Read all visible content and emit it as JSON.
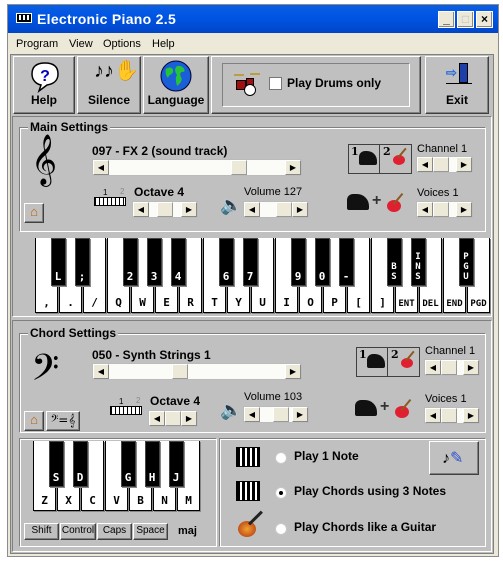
{
  "window": {
    "title": "Electronic Piano 2.5",
    "controls": {
      "minimize": "_",
      "maximize": "□",
      "close": "×"
    }
  },
  "menu": [
    "Program",
    "View",
    "Options",
    "Help"
  ],
  "toolbar": {
    "help": {
      "label": "Help",
      "icon": "question-bubble-icon"
    },
    "silence": {
      "label": "Silence",
      "icon": "notes-hand-icon"
    },
    "language": {
      "label": "Language",
      "icon": "globe-icon"
    },
    "drums": {
      "label": "Play Drums only",
      "checked": false,
      "icon": "drum-kit-icon"
    },
    "exit": {
      "label": "Exit",
      "icon": "exit-door-icon"
    }
  },
  "main_settings": {
    "title": "Main Settings",
    "clef": "treble",
    "instrument": "097 - FX 2 (sound track)",
    "instrument_value": 97,
    "instrument_max": 127,
    "octave_label": "Octave 4",
    "octave_value": 4,
    "octave_scale": [
      "1",
      "2"
    ],
    "volume_label": "Volume 127",
    "volume_value": 127,
    "channel_label": "Channel 1",
    "channel_value": 1,
    "voices_label": "Voices 1",
    "voices_value": 1,
    "channel_tabs": [
      "1",
      "2"
    ],
    "plus": "+"
  },
  "main_keyboard": {
    "white_keys": [
      ",",
      ".",
      "/",
      "Q",
      "W",
      "E",
      "R",
      "T",
      "Y",
      "U",
      "I",
      "O",
      "P",
      "[",
      "]",
      "ENT",
      "DEL",
      "END",
      "PGD"
    ],
    "black_keys": [
      {
        "label": "L",
        "after": 0
      },
      {
        "label": ";",
        "after": 1
      },
      {
        "label": "2",
        "after": 3
      },
      {
        "label": "3",
        "after": 4
      },
      {
        "label": "4",
        "after": 5
      },
      {
        "label": "6",
        "after": 7
      },
      {
        "label": "7",
        "after": 8
      },
      {
        "label": "9",
        "after": 10
      },
      {
        "label": "0",
        "after": 11
      },
      {
        "label": "-",
        "after": 12
      },
      {
        "label": "B\nS",
        "after": 14
      },
      {
        "label": "I\nN\nS",
        "after": 15
      },
      {
        "label": "P\nG\nU",
        "after": 17
      }
    ]
  },
  "chord_settings": {
    "title": "Chord Settings",
    "clef": "bass",
    "instrument": "050 - Synth Strings 1",
    "instrument_value": 50,
    "instrument_max": 127,
    "octave_label": "Octave 4",
    "octave_value": 4,
    "octave_scale": [
      "1",
      "2"
    ],
    "volume_label": "Volume 103",
    "volume_value": 103,
    "channel_label": "Channel 1",
    "channel_value": 1,
    "voices_label": "Voices 1",
    "voices_value": 1,
    "channel_tabs": [
      "1",
      "2"
    ],
    "plus": "+"
  },
  "chord_keyboard": {
    "white_keys": [
      "Z",
      "X",
      "C",
      "V",
      "B",
      "N",
      "M"
    ],
    "black_keys": [
      {
        "label": "S",
        "after": 0
      },
      {
        "label": "D",
        "after": 1
      },
      {
        "label": "G",
        "after": 3
      },
      {
        "label": "H",
        "after": 4
      },
      {
        "label": "J",
        "after": 5
      }
    ],
    "modifiers": [
      "Shift",
      "Control",
      "Caps",
      "Space"
    ],
    "chord_type": "maj"
  },
  "chord_modes": [
    {
      "label": "Play 1 Note",
      "selected": false,
      "icon": "piano-keys-icon"
    },
    {
      "label": "Play Chords using 3 Notes",
      "selected": true,
      "icon": "piano-keys-icon"
    },
    {
      "label": "Play Chords like a Guitar",
      "selected": false,
      "icon": "guitar-icon"
    }
  ],
  "colors": {
    "titlebar": "#0055e5",
    "client": "#c0c0c0",
    "frame": "#ece9d8"
  }
}
